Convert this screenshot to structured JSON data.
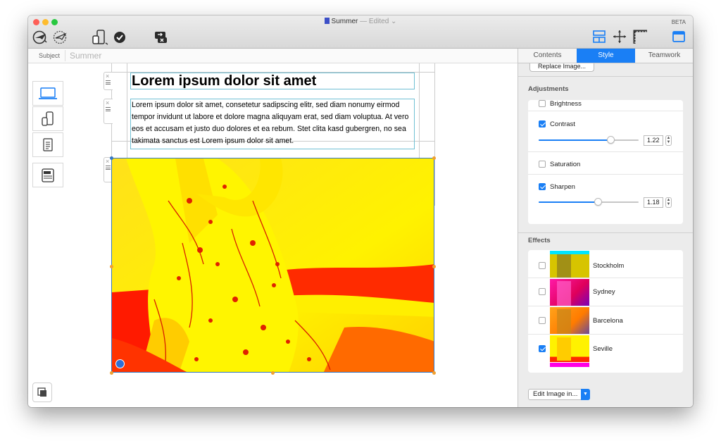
{
  "window": {
    "title": "Summer",
    "edited": "— Edited",
    "beta_badge": "BETA",
    "traffic_lights": {
      "close": "#fe5f57",
      "minimize": "#febc2e",
      "zoom": "#28c840"
    }
  },
  "toolbar": {
    "left_icons": [
      "share-plane-icon",
      "publish-plane-icon",
      "device-preview-icon",
      "check-badge-icon",
      "comments-icon"
    ],
    "right_icons": [
      "layout-icon",
      "move-icon",
      "ruler-icon",
      "sidebar-toggle-icon"
    ],
    "accent": "#1a7ff5"
  },
  "subject": {
    "label": "Subject",
    "value": "Summer"
  },
  "canvas": {
    "heading": "Lorem ipsum dolor sit amet",
    "paragraph": "Lorem ipsum dolor sit amet, consetetur sadipscing elitr, sed diam nonumy eirmod tempor invidunt ut labore et dolore magna aliquyam erat, sed diam voluptua. At vero eos et accusam et justo duo dolores et ea rebum. Stet clita kasd gubergren, no sea takimata sanctus est Lorem ipsum dolor sit amet.",
    "device_buttons": [
      "laptop-icon",
      "phone-tablet-icon",
      "document-icon",
      "newsletter-icon"
    ],
    "bottom_button": "layers-icon"
  },
  "panel": {
    "tabs": [
      {
        "label": "Contents",
        "active": false
      },
      {
        "label": "Style",
        "active": true
      },
      {
        "label": "Teamwork",
        "active": false
      }
    ],
    "replace_button": "Replace Image...",
    "adjustments": {
      "title": "Adjustments",
      "brightness": {
        "label": "Brightness",
        "checked": false
      },
      "contrast": {
        "label": "Contrast",
        "checked": true,
        "value": "1.22",
        "level": 0.72
      },
      "saturation": {
        "label": "Saturation",
        "checked": false
      },
      "sharpen": {
        "label": "Sharpen",
        "checked": true,
        "value": "1.18",
        "level": 0.59
      }
    },
    "effects": {
      "title": "Effects",
      "items": [
        {
          "label": "Stockholm",
          "checked": false
        },
        {
          "label": "Sydney",
          "checked": false
        },
        {
          "label": "Barcelona",
          "checked": false
        },
        {
          "label": "Seville",
          "checked": true
        }
      ]
    },
    "edit_button": "Edit Image in..."
  }
}
